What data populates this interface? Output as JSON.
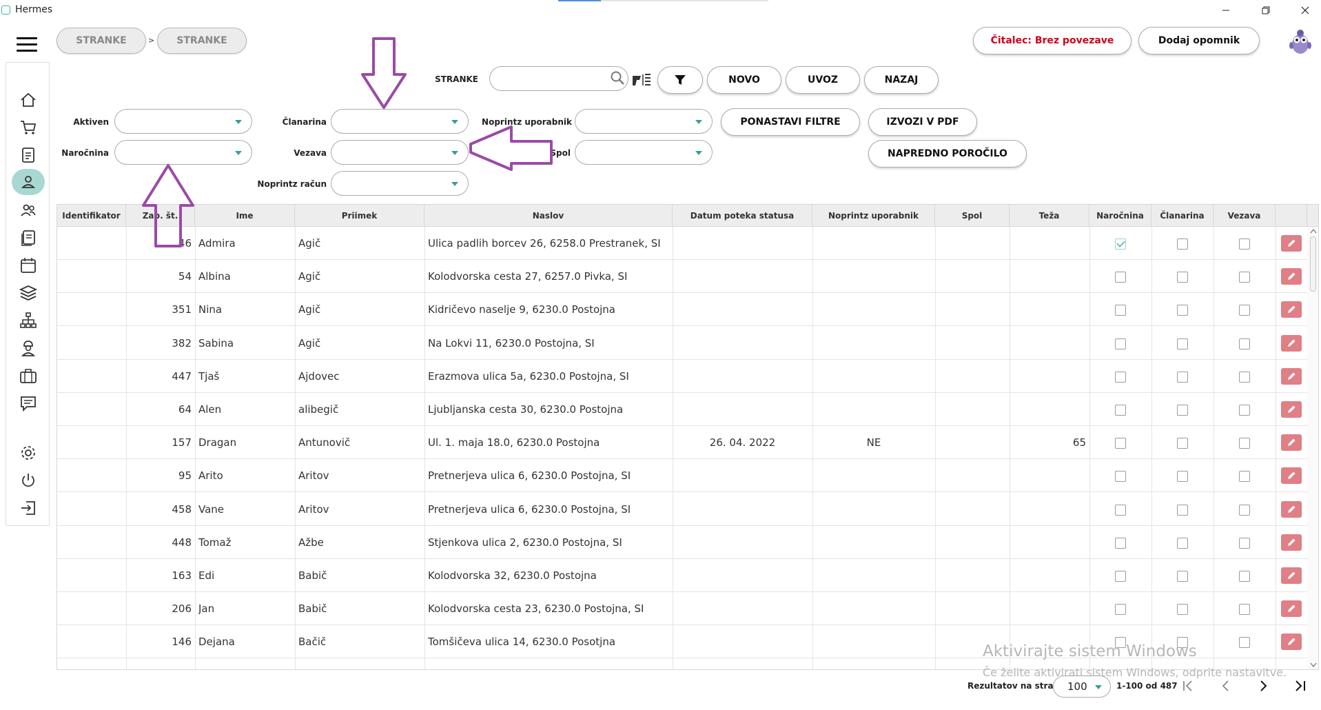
{
  "window": {
    "title": "Hermes"
  },
  "breadcrumb": {
    "items": [
      "STRANKE",
      "STRANKE"
    ],
    "separator": ">"
  },
  "header": {
    "reader_status": "Čitalec: Brez povezave",
    "add_reminder": "Dodaj opomnik"
  },
  "search": {
    "label": "STRANKE",
    "value": "",
    "placeholder": ""
  },
  "toolbar": {
    "novo": "NOVO",
    "uvoz": "UVOZ",
    "nazaj": "NAZAJ",
    "reset_filters": "PONASTAVI FILTRE",
    "export_pdf": "IZVOZI V PDF",
    "advanced_report": "NAPREDNO POROČILO"
  },
  "filters": {
    "aktiven": {
      "label": "Aktiven",
      "value": ""
    },
    "narocnina": {
      "label": "Naročnina",
      "value": ""
    },
    "clanarina": {
      "label": "Članarina",
      "value": ""
    },
    "vezava": {
      "label": "Vezava",
      "value": ""
    },
    "noprintz_racun": {
      "label": "Noprintz račun",
      "value": ""
    },
    "noprintz_uporabnik": {
      "label": "Noprintz uporabnik",
      "value": ""
    },
    "spol": {
      "label": "Spol",
      "value": ""
    }
  },
  "table": {
    "columns": [
      "Identifikator",
      "Zap. št.",
      "Ime",
      "Priimek",
      "Naslov",
      "Datum poteka statusa",
      "Noprintz uporabnik",
      "Spol",
      "Teža",
      "Naročnina",
      "Članarina",
      "Vezava"
    ],
    "rows": [
      {
        "id": "",
        "zap": "46",
        "ime": "Admira",
        "priimek": "Agič",
        "naslov": "Ulica padlih borcev 26, 6258.0 Prestranek, SI",
        "datum": "",
        "noprintz": "",
        "spol": "",
        "teza": "",
        "narocnina": true,
        "clanarina": false,
        "vezava": false
      },
      {
        "id": "",
        "zap": "54",
        "ime": "Albina",
        "priimek": "Agič",
        "naslov": "Kolodvorska cesta 27, 6257.0 Pivka, SI",
        "datum": "",
        "noprintz": "",
        "spol": "",
        "teza": "",
        "narocnina": false,
        "clanarina": false,
        "vezava": false
      },
      {
        "id": "",
        "zap": "351",
        "ime": "Nina",
        "priimek": "Agič",
        "naslov": "Kidričevo naselje 9, 6230.0 Postojna",
        "datum": "",
        "noprintz": "",
        "spol": "",
        "teza": "",
        "narocnina": false,
        "clanarina": false,
        "vezava": false
      },
      {
        "id": "",
        "zap": "382",
        "ime": "Sabina",
        "priimek": "Agič",
        "naslov": "Na Lokvi 11, 6230.0 Postojna, SI",
        "datum": "",
        "noprintz": "",
        "spol": "",
        "teza": "",
        "narocnina": false,
        "clanarina": false,
        "vezava": false
      },
      {
        "id": "",
        "zap": "447",
        "ime": "Tjaš",
        "priimek": "Ajdovec",
        "naslov": "Erazmova ulica 5a, 6230.0 Postojna, SI",
        "datum": "",
        "noprintz": "",
        "spol": "",
        "teza": "",
        "narocnina": false,
        "clanarina": false,
        "vezava": false
      },
      {
        "id": "",
        "zap": "64",
        "ime": "Alen",
        "priimek": "alibegič",
        "naslov": "Ljubljanska cesta 30, 6230.0 Postojna",
        "datum": "",
        "noprintz": "",
        "spol": "",
        "teza": "",
        "narocnina": false,
        "clanarina": false,
        "vezava": false
      },
      {
        "id": "",
        "zap": "157",
        "ime": "Dragan",
        "priimek": "Antunovič",
        "naslov": "Ul. 1. maja 18.0, 6230.0 Postojna",
        "datum": "26. 04. 2022",
        "noprintz": "NE",
        "spol": "",
        "teza": "65",
        "narocnina": false,
        "clanarina": false,
        "vezava": false
      },
      {
        "id": "",
        "zap": "95",
        "ime": "Arito",
        "priimek": "Aritov",
        "naslov": "Pretnerjeva ulica 6, 6230.0 Postojna, SI",
        "datum": "",
        "noprintz": "",
        "spol": "",
        "teza": "",
        "narocnina": false,
        "clanarina": false,
        "vezava": false
      },
      {
        "id": "",
        "zap": "458",
        "ime": "Vane",
        "priimek": "Aritov",
        "naslov": "Pretnerjeva ulica 6, 6230.0 Postojna, SI",
        "datum": "",
        "noprintz": "",
        "spol": "",
        "teza": "",
        "narocnina": false,
        "clanarina": false,
        "vezava": false
      },
      {
        "id": "",
        "zap": "448",
        "ime": "Tomaž",
        "priimek": "Ažbe",
        "naslov": "Stjenkova ulica 2, 6230.0 Postojna, SI",
        "datum": "",
        "noprintz": "",
        "spol": "",
        "teza": "",
        "narocnina": false,
        "clanarina": false,
        "vezava": false
      },
      {
        "id": "",
        "zap": "163",
        "ime": "Edi",
        "priimek": "Babič",
        "naslov": "Kolodvorska 32, 6230.0 Postojna",
        "datum": "",
        "noprintz": "",
        "spol": "",
        "teza": "",
        "narocnina": false,
        "clanarina": false,
        "vezava": false
      },
      {
        "id": "",
        "zap": "206",
        "ime": "Jan",
        "priimek": "Babič",
        "naslov": "Kolodvorska cesta 23, 6230.0 Postojna, SI",
        "datum": "",
        "noprintz": "",
        "spol": "",
        "teza": "",
        "narocnina": false,
        "clanarina": false,
        "vezava": false
      },
      {
        "id": "",
        "zap": "146",
        "ime": "Dejana",
        "priimek": "Bačič",
        "naslov": "Tomšičeva ulica 14, 6230.0 Posotjna",
        "datum": "",
        "noprintz": "",
        "spol": "",
        "teza": "",
        "narocnina": false,
        "clanarina": false,
        "vezava": false
      }
    ]
  },
  "pagination": {
    "label": "Rezultatov na stran",
    "page_size": "100",
    "range": "1-100 od 487"
  },
  "watermark": {
    "line1": "Aktivirajte sistem Windows",
    "line2": "Če želite aktivirati sistem Windows, odprite nastavitve."
  },
  "colors": {
    "accent_teal": "#3a9e96",
    "edit_button": "#e07f86",
    "status_red": "#d0021b",
    "annotation_purple": "#9b4aa8"
  }
}
